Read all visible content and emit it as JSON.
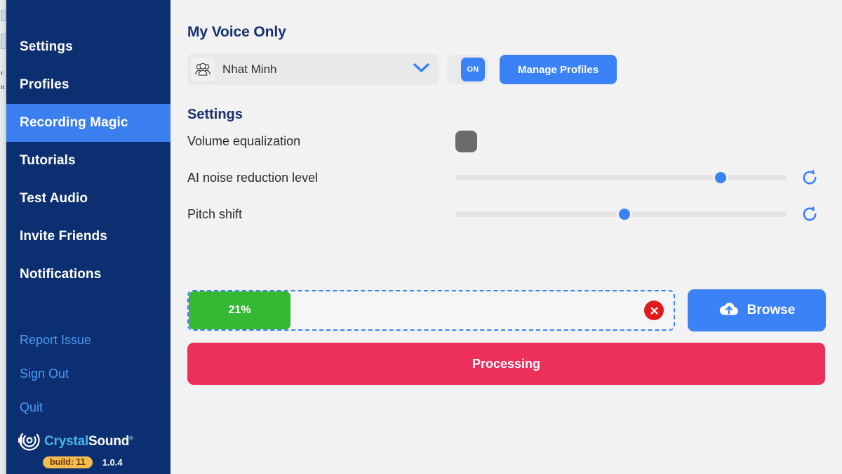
{
  "sidebar": {
    "nav_items": [
      {
        "label": "Settings",
        "active": false
      },
      {
        "label": "Profiles",
        "active": false
      },
      {
        "label": "Recording Magic",
        "active": true
      },
      {
        "label": "Tutorials",
        "active": false
      },
      {
        "label": "Test Audio",
        "active": false
      },
      {
        "label": "Invite Friends",
        "active": false
      },
      {
        "label": "Notifications",
        "active": false
      }
    ],
    "links": [
      {
        "label": "Report Issue"
      },
      {
        "label": "Sign Out"
      },
      {
        "label": "Quit"
      }
    ],
    "brand": {
      "name_part1": "Crystal",
      "name_part2": "Sound",
      "registered": "®",
      "build_badge": "build: 11",
      "version": "1.0.4"
    },
    "colors": {
      "background": "#0b2f70",
      "active_item": "#3b7ef0",
      "link": "#4e9bf0",
      "badge": "#f2bc4e"
    }
  },
  "main": {
    "page_title": "My Voice Only",
    "profile_select": {
      "value": "Nhat Minh",
      "icon": "people-group-icon",
      "chevron": "chevron-down-icon"
    },
    "voice_toggle": {
      "state_label": "ON",
      "enabled": true
    },
    "manage_profiles_button": "Manage Profiles",
    "settings_section": {
      "title": "Settings",
      "rows": [
        {
          "label": "Volume equalization",
          "control": "square-toggle",
          "value": "off",
          "color": "#6b6b6b"
        },
        {
          "label": "AI noise reduction level",
          "control": "slider",
          "percent": 80,
          "reset_icon": "refresh-icon"
        },
        {
          "label": "Pitch shift",
          "control": "slider",
          "percent": 51,
          "reset_icon": "refresh-icon"
        }
      ]
    },
    "upload": {
      "progress_label": "21%",
      "progress_percent": 21,
      "progress_color": "#35b834",
      "cancel_icon": "close-circle-icon",
      "browse_button": "Browse",
      "browse_icon": "cloud-upload-icon",
      "dropzone_border_color": "#3b82f6"
    },
    "action_button": {
      "label": "Processing",
      "color": "#ec2f5b"
    },
    "colors": {
      "background": "#f2f2f2",
      "heading": "#15306b",
      "accent": "#3b82f6"
    }
  }
}
